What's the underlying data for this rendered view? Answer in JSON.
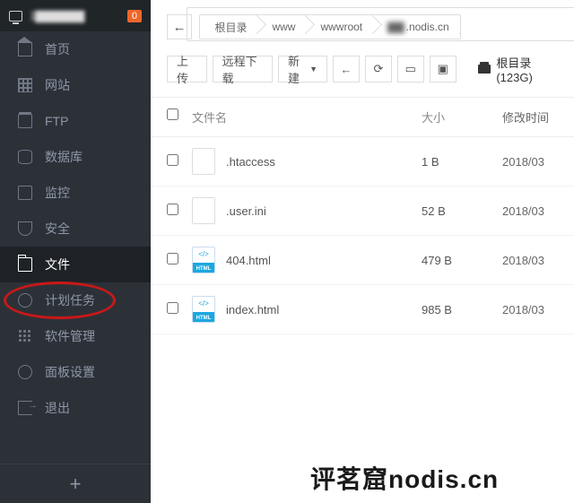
{
  "header": {
    "ip_masked": "1▇▇▇▇▇▇",
    "badge": "0"
  },
  "sidebar": {
    "items": [
      {
        "label": "首页",
        "icon": "home-icon"
      },
      {
        "label": "网站",
        "icon": "grid-icon"
      },
      {
        "label": "FTP",
        "icon": "stack-icon"
      },
      {
        "label": "数据库",
        "icon": "db-icon"
      },
      {
        "label": "监控",
        "icon": "monitor-icon"
      },
      {
        "label": "安全",
        "icon": "shield-icon"
      },
      {
        "label": "文件",
        "icon": "folder-icon",
        "active": true
      },
      {
        "label": "计划任务",
        "icon": "clock-icon"
      },
      {
        "label": "软件管理",
        "icon": "apps-icon"
      },
      {
        "label": "面板设置",
        "icon": "gear-icon"
      },
      {
        "label": "退出",
        "icon": "exit-icon"
      }
    ],
    "add": "+"
  },
  "breadcrumb": {
    "back": "←",
    "segs": [
      "根目录",
      "www",
      "wwwroot",
      ".nodis.cn"
    ],
    "seg3_prefix_blurred": "▇▇"
  },
  "toolbar": {
    "upload": "上传",
    "remote": "远程下载",
    "new": "新建",
    "back": "←",
    "refresh": "⟳",
    "view": "▭",
    "term": "▣",
    "disk_label": "根目录(123G)"
  },
  "table": {
    "headers": {
      "name": "文件名",
      "size": "大小",
      "time": "修改时间"
    },
    "rows": [
      {
        "name": ".htaccess",
        "size": "1 B",
        "time": "2018/03",
        "type": "file"
      },
      {
        "name": ".user.ini",
        "size": "52 B",
        "time": "2018/03",
        "type": "file"
      },
      {
        "name": "404.html",
        "size": "479 B",
        "time": "2018/03",
        "type": "html"
      },
      {
        "name": "index.html",
        "size": "985 B",
        "time": "2018/03",
        "type": "html"
      }
    ]
  },
  "watermark": "评茗窟nodis.cn",
  "annotations": {
    "breadcrumb_circle": true,
    "file_menu_circle": true
  }
}
